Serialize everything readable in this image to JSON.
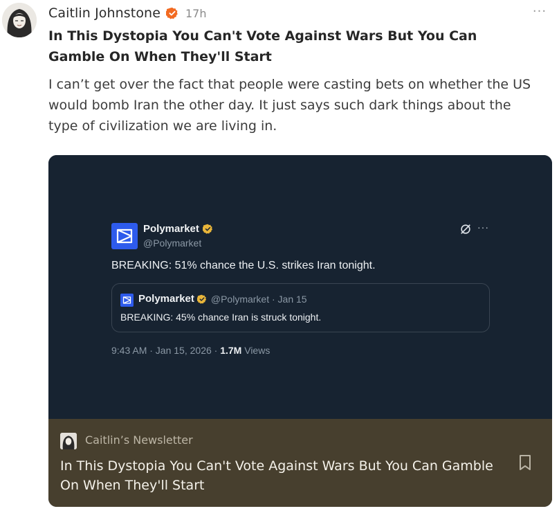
{
  "post": {
    "author": "Caitlin Johnstone",
    "time": "17h",
    "more_label": "···",
    "title": "In This Dystopia You Can't Vote Against Wars But You Can Gamble On When They'll Start",
    "body": "I can’t get over the fact that people were casting bets on whether the US would bomb Iran the other day. It just says such dark things about the type of civilization we are living in."
  },
  "embed": {
    "tweet": {
      "name": "Polymarket",
      "handle": "@Polymarket",
      "more": "···",
      "text": "BREAKING: 51% chance the U.S. strikes Iran tonight.",
      "quote": {
        "name": "Polymarket",
        "handle": "@Polymarket · Jan 15",
        "text": "BREAKING: 45% chance Iran is struck tonight."
      },
      "meta_time": "9:43 AM · Jan 15, 2026 · ",
      "meta_views_count": "1.7M",
      "meta_views_label": " Views"
    },
    "newsletter": "Caitlin’s Newsletter",
    "title": "In This Dystopia You Can't Vote Against Wars But You Can Gamble On When They'll Start"
  },
  "colors": {
    "verified": "#f26a21",
    "polymarket_blue": "#2e5bec",
    "tweet_bg": "#172331",
    "footer_bg": "#473f2e"
  },
  "icons": {
    "verified": "verified-badge-icon",
    "grok": "grok-icon",
    "bookmark": "bookmark-icon"
  }
}
